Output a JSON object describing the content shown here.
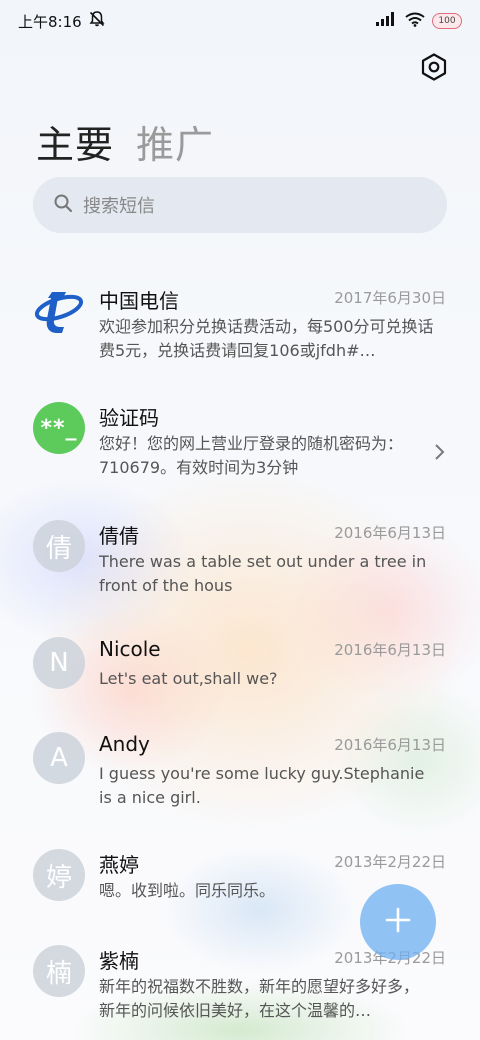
{
  "status_bar": {
    "time": "上午8:16",
    "icons": [
      "muted-bell-icon",
      "signal-icon",
      "wifi-icon",
      "battery-icon"
    ],
    "battery": "100"
  },
  "header": {
    "settings_icon": "settings-hex-icon",
    "tabs": [
      {
        "label": "主要",
        "active": true
      },
      {
        "label": "推广",
        "active": false
      }
    ]
  },
  "search": {
    "placeholder": "搜索短信",
    "icon": "search-icon"
  },
  "messages": [
    {
      "name": "中国电信",
      "date": "2017年6月30日",
      "text": "欢迎参加积分兑换话费活动，每500分可兑换话费5元，兑换话费请回复106或jfdh#…",
      "avatar": "china-telecom-logo"
    },
    {
      "name": "验证码",
      "date": "",
      "text": "您好！您的网上营业厅登录的随机密码为：710679。有效时间为3分钟",
      "avatar": "**_"
    },
    {
      "name": "倩倩",
      "date": "2016年6月13日",
      "text": "There was a table set out under a tree in front of the hous",
      "avatar": "倩"
    },
    {
      "name": "Nicole",
      "date": "2016年6月13日",
      "text": "Let's eat out,shall we?",
      "avatar": "N"
    },
    {
      "name": "Andy",
      "date": "2016年6月13日",
      "text": "I guess you're some lucky guy.Stephanie is a nice girl.",
      "avatar": "A"
    },
    {
      "name": "燕婷",
      "date": "2013年2月22日",
      "text": "嗯。收到啦。同乐同乐。",
      "avatar": "婷"
    },
    {
      "name": "紫楠",
      "date": "2013年2月22日",
      "text": "新年的祝福数不胜数，新年的愿望好多好多，新年的问候依旧美好，在这个温馨的…",
      "avatar": "楠"
    }
  ],
  "fab": {
    "icon": "plus-icon"
  },
  "colors": {
    "accent": "#6eaff0",
    "verify_avatar": "#5dcb5b",
    "telecom_blue": "#1e5fc8"
  }
}
